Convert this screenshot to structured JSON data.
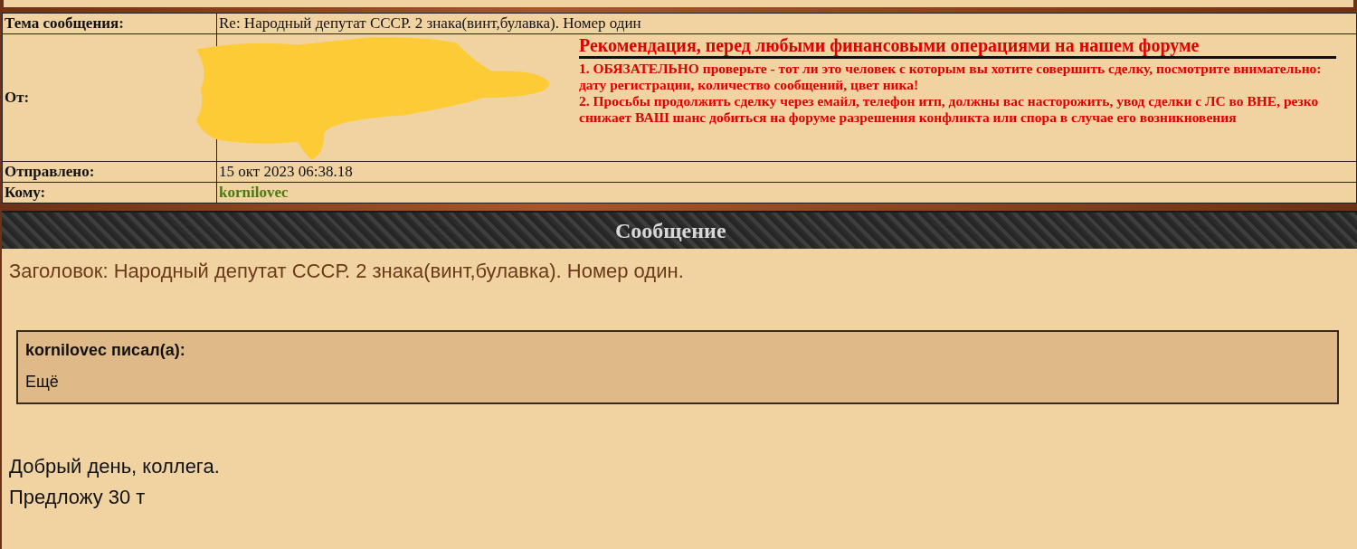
{
  "header_table": {
    "rows": [
      {
        "kind": "text",
        "label": "Тема сообщения:",
        "value": "Re: Народный депутат СССР. 2 знака(винт,булавка). Номер один"
      },
      {
        "kind": "from",
        "label": "От:",
        "warning": {
          "title": "Рекомендация, перед любыми финансовыми операциями на нашем форуме",
          "lines": [
            "1. ОБЯЗАТЕЛЬНО проверьте - тот ли это человек с которым вы хотите совершить сделку, посмотрите внимательно: дату регистрации, количество сообщений, цвет ника!",
            "2. Просьбы продолжить сделку через емайл, телефон итп, должны вас насторожить, увод сделки с ЛС во ВНЕ, резко снижает ВАШ шанс добиться на форуме разрешения конфликта или спора в случае его возникновения"
          ]
        }
      },
      {
        "kind": "text",
        "label": "Отправлено:",
        "value": "15 окт 2023 06:38.18"
      },
      {
        "kind": "user",
        "label": "Кому:",
        "value": "kornilovec",
        "color": "#4a7a12"
      }
    ]
  },
  "message": {
    "header": "Сообщение",
    "subject": "Заголовок: Народный депутат СССР. 2 знака(винт,булавка). Номер один.",
    "quote": {
      "author": "kornilovec писал(а):",
      "text": "Ещё"
    },
    "body": [
      "Добрый день, коллега.",
      "Предложу 30 т"
    ]
  }
}
